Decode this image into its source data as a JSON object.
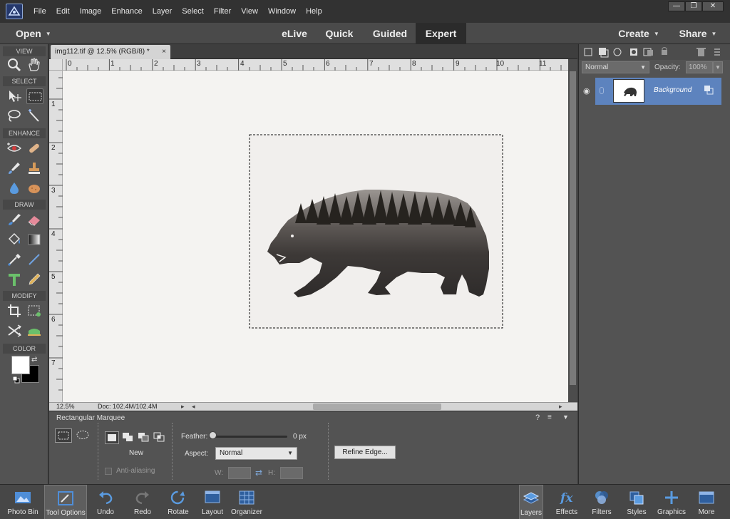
{
  "menu": {
    "items": [
      "File",
      "Edit",
      "Image",
      "Enhance",
      "Layer",
      "Select",
      "Filter",
      "View",
      "Window",
      "Help"
    ],
    "window_controls": {
      "minimize": "—",
      "restore": "❐",
      "close": "✕"
    }
  },
  "modebar": {
    "open_label": "Open",
    "modes": [
      "eLive",
      "Quick",
      "Guided",
      "Expert"
    ],
    "active_mode": "Expert",
    "create_label": "Create",
    "share_label": "Share"
  },
  "toolbox": {
    "view": "VIEW",
    "select": "SELECT",
    "enhance": "ENHANCE",
    "draw": "DRAW",
    "modify": "MODIFY",
    "color": "COLOR",
    "foreground_color": "#ffffff",
    "background_color": "#000000"
  },
  "document": {
    "tab_title": "img112.tif @ 12.5% (RGB/8) *",
    "tab_close": "×",
    "ruler_h": [
      "0",
      "1",
      "2",
      "3",
      "4",
      "5",
      "6",
      "7",
      "8",
      "9",
      "10",
      "11"
    ],
    "ruler_v": [
      "1",
      "2",
      "3",
      "4",
      "5",
      "6",
      "7"
    ],
    "zoom": "12.5%",
    "doc_size": "Doc: 102.4M/102.4M"
  },
  "options": {
    "tool_name": "Rectangular Marquee",
    "new_label": "New",
    "anti_aliasing": "Anti-aliasing",
    "feather_label": "Feather:",
    "feather_value": "0 px",
    "feather_level": 0,
    "aspect_label": "Aspect:",
    "aspect_value": "Normal",
    "w_label": "W:",
    "h_label": "H:",
    "refine_edge": "Refine Edge..."
  },
  "layers_panel": {
    "blend_mode": "Normal",
    "opacity_label": "Opacity:",
    "opacity_value": "100%",
    "layer_name": "Background"
  },
  "bottombar": {
    "left": [
      {
        "label": "Photo Bin",
        "icon": "photo-bin-icon"
      },
      {
        "label": "Tool Options",
        "icon": "tool-options-icon"
      },
      {
        "label": "Undo",
        "icon": "undo-icon"
      },
      {
        "label": "Redo",
        "icon": "redo-icon"
      },
      {
        "label": "Rotate",
        "icon": "rotate-icon"
      },
      {
        "label": "Layout",
        "icon": "layout-icon"
      },
      {
        "label": "Organizer",
        "icon": "organizer-icon"
      }
    ],
    "right": [
      {
        "label": "Layers",
        "icon": "layers-icon"
      },
      {
        "label": "Effects",
        "icon": "effects-icon"
      },
      {
        "label": "Filters",
        "icon": "filters-icon"
      },
      {
        "label": "Styles",
        "icon": "styles-icon"
      },
      {
        "label": "Graphics",
        "icon": "graphics-icon"
      },
      {
        "label": "More",
        "icon": "more-icon"
      }
    ]
  }
}
